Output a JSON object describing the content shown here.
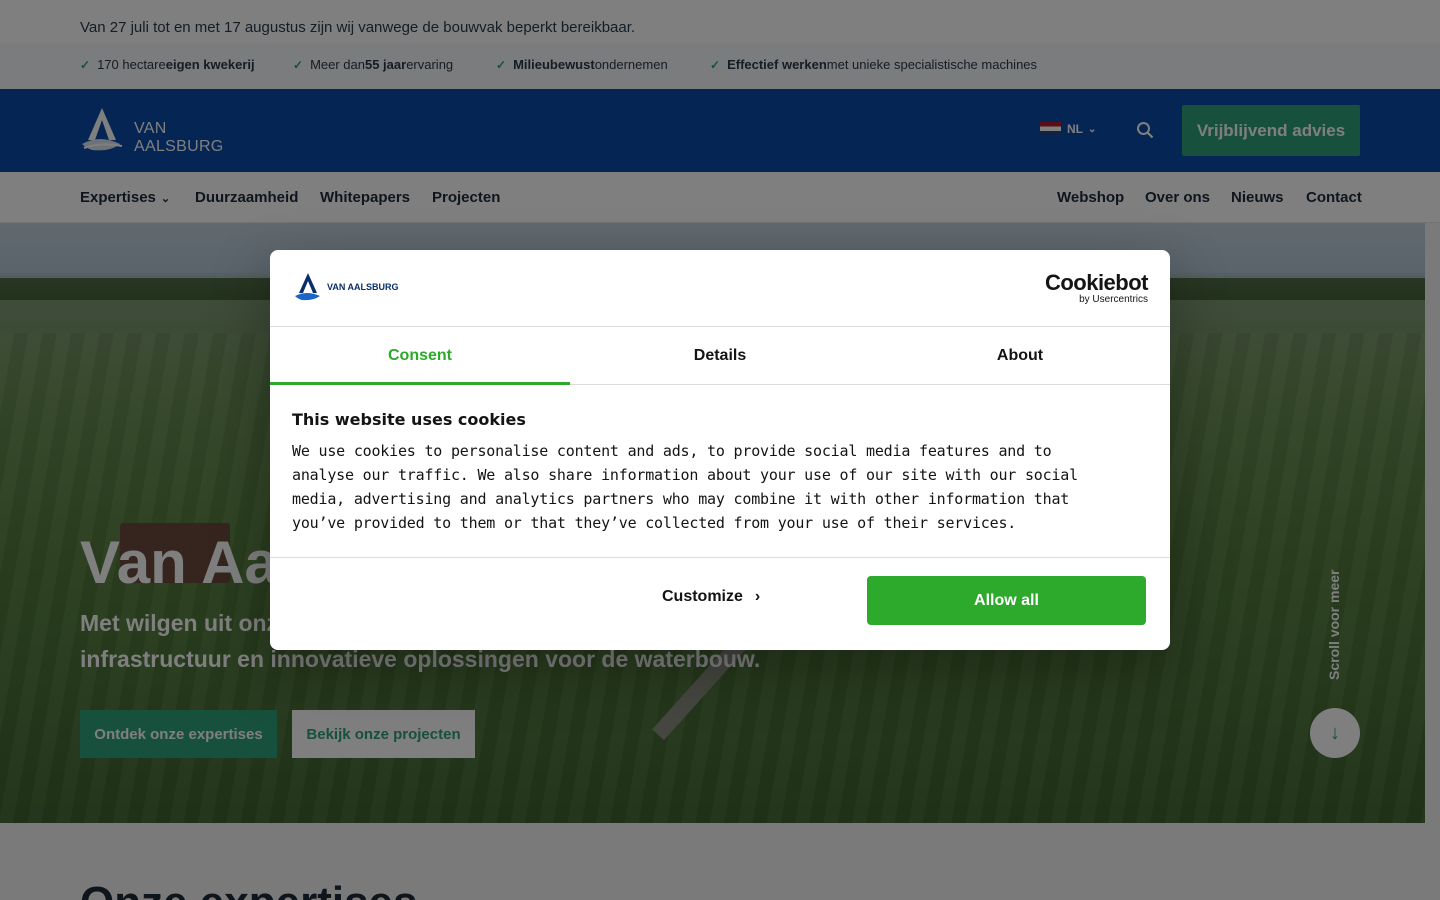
{
  "announcement": "Van 27 juli tot en met 17 augustus zijn wij vanwege de bouwvak beperkt bereikbaar.",
  "usps": [
    {
      "pre": "170 hectare ",
      "bold": "eigen kwekerij",
      "post": ""
    },
    {
      "pre": "Meer dan ",
      "bold": "55 jaar",
      "post": " ervaring"
    },
    {
      "pre": "",
      "bold": "Milieubewust",
      "post": " ondernemen"
    },
    {
      "pre": "",
      "bold": "Effectief werken",
      "post": " met unieke specialistische machines"
    }
  ],
  "header": {
    "logo_text": "VAN AALSBURG",
    "language": "NL",
    "cta_label": "Vrijblijvend advies"
  },
  "nav": {
    "left": [
      "Expertises",
      "Duurzaamheid",
      "Whitepapers",
      "Projecten"
    ],
    "right": [
      "Webshop",
      "Over ons",
      "Nieuws",
      "Contact"
    ]
  },
  "hero": {
    "title": "Van Aalsburg",
    "subtitle": "Met wilgen uit onze eigen kwekerij zorgen we sinds 1964 voor duurzame infrastructuur en innovatieve oplossingen voor de waterbouw.",
    "primary_button": "Ontdek onze expertises",
    "secondary_button": "Bekijk onze projecten",
    "scroll_label": "Scroll voor meer"
  },
  "section_title": "Onze expertises",
  "cookie_dialog": {
    "logo_text": "VAN AALSBURG",
    "provider_brand": "Cookiebot",
    "provider_by": "by Usercentrics",
    "tabs": [
      "Consent",
      "Details",
      "About"
    ],
    "active_tab": "Consent",
    "title": "This website uses cookies",
    "body": "We use cookies to personalise content and ads, to provide social media features and to analyse our traffic. We also share information about your use of our site with our social media, advertising and analytics partners who may combine it with other information that you’ve provided to them or that they’ve collected from your use of their services.",
    "customize_label": "Customize",
    "allow_label": "Allow all"
  },
  "colors": {
    "brand_blue": "#0a4ba8",
    "brand_green": "#2ea07a",
    "cookie_green": "#2da92b"
  }
}
